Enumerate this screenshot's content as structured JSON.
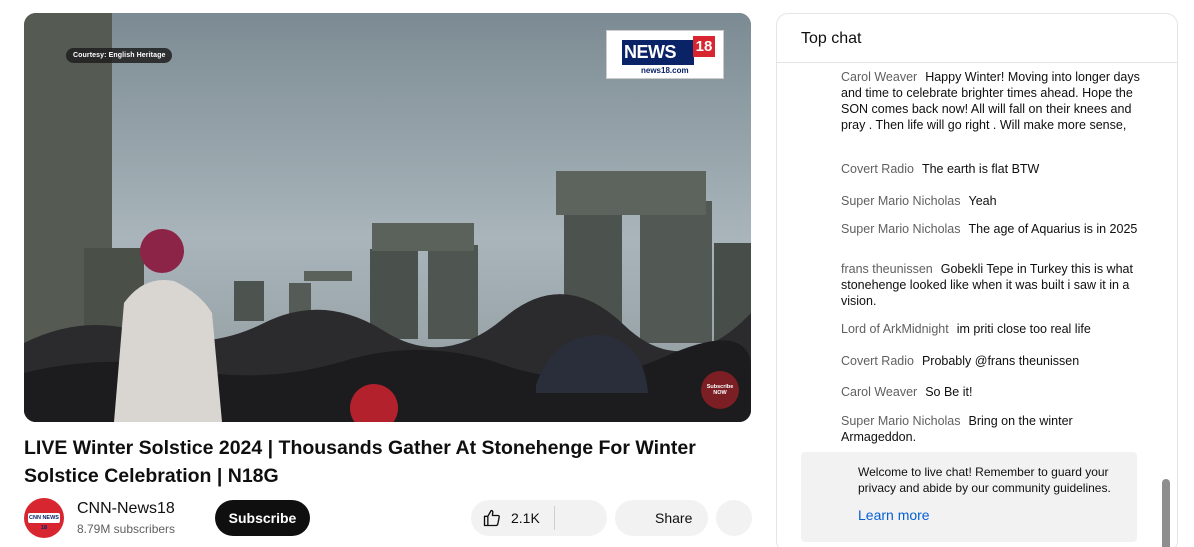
{
  "video": {
    "courtesy": "Courtesy: English Heritage",
    "logo_word": "NEWS",
    "logo_number": "18",
    "logo_url": "news18.com",
    "subscribe_badge": "Subscribe NOW",
    "title": "LIVE Winter Solstice 2024 | Thousands Gather At Stonehenge For Winter Solstice Celebration | N18G"
  },
  "channel": {
    "avatar_label": "CNN NEWS 18",
    "name": "CNN-News18",
    "subscribers": "8.79M subscribers",
    "subscribe_label": "Subscribe"
  },
  "actions": {
    "like_count": "2.1K",
    "share_label": "Share"
  },
  "chat": {
    "title": "Top chat",
    "messages": [
      {
        "author": "Carol Weaver",
        "text": "Happy Winter! Moving into longer days and time to celebrate brighter times ahead. Hope the SON comes back now! All will fall on their knees and pray . Then life will go right . Will make more sense,"
      },
      {
        "author": "Covert Radio",
        "text": "The earth is flat BTW"
      },
      {
        "author": "Super Mario Nicholas",
        "text": "Yeah"
      },
      {
        "author": "Super Mario Nicholas",
        "text": "The age of Aquarius is in 2025"
      },
      {
        "author": "frans theunissen",
        "text": "Gobekli Tepe in Turkey this is what stonehenge looked like when it was built i saw it in a vision."
      },
      {
        "author": "Lord of ArkMidnight",
        "text": "im priti close too real life"
      },
      {
        "author": "Covert Radio",
        "text": "Probably @frans theunissen"
      },
      {
        "author": "Carol Weaver",
        "text": "So Be it!"
      },
      {
        "author": "Super Mario Nicholas",
        "text": "Bring on the winter Armageddon."
      }
    ],
    "notice_text": "Welcome to live chat! Remember to guard your privacy and abide by our community guidelines.",
    "learn_more": "Learn more"
  },
  "colors": {
    "subscribe_bg": "#0f0f0f",
    "brand_red": "#d7262f",
    "link_blue": "#065fd4"
  }
}
